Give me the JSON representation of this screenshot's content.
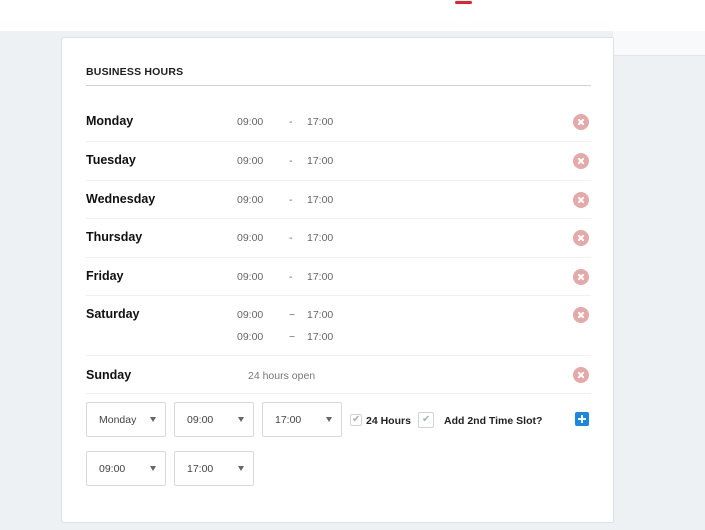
{
  "section": {
    "title": "BUSINESS HOURS"
  },
  "schedule": [
    {
      "day": "Monday",
      "slots": [
        {
          "open": "09:00",
          "sep": "-",
          "close": "17:00"
        }
      ]
    },
    {
      "day": "Tuesday",
      "slots": [
        {
          "open": "09:00",
          "sep": "-",
          "close": "17:00"
        }
      ]
    },
    {
      "day": "Wednesday",
      "slots": [
        {
          "open": "09:00",
          "sep": "-",
          "close": "17:00"
        }
      ]
    },
    {
      "day": "Thursday",
      "slots": [
        {
          "open": "09:00",
          "sep": "-",
          "close": "17:00"
        }
      ]
    },
    {
      "day": "Friday",
      "slots": [
        {
          "open": "09:00",
          "sep": "-",
          "close": "17:00"
        }
      ]
    },
    {
      "day": "Saturday",
      "slots": [
        {
          "open": "09:00",
          "sep": "~",
          "close": "17:00"
        },
        {
          "open": "09:00",
          "sep": "~",
          "close": "17:00"
        }
      ]
    },
    {
      "day": "Sunday",
      "note": "24 hours open"
    }
  ],
  "form": {
    "day_select": "Monday",
    "open_select": "09:00",
    "close_select": "17:00",
    "hours24_label": "24 Hours",
    "hours24_checked": true,
    "second_slot_label": "Add 2nd Time Slot?",
    "second_slot_checked": true,
    "slot2_open_select": "09:00",
    "slot2_close_select": "17:00"
  },
  "colors": {
    "remove_icon": "#e5a9a9",
    "add_button": "#1a87e0",
    "brand_accent": "#e0242f"
  }
}
